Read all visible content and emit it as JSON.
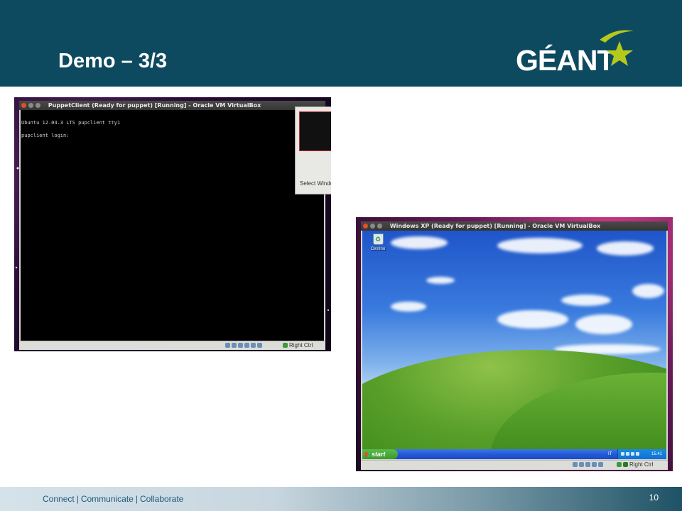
{
  "slide": {
    "title": "Demo – 3/3",
    "logo_text": "GÉANT",
    "page_number": "10"
  },
  "footer": {
    "items": [
      "Connect",
      "Communicate",
      "Collaborate"
    ],
    "separator": "|"
  },
  "screenshot_left": {
    "window_title": "PuppetClient (Ready for puppet) [Running] - Oracle VM VirtualBox",
    "console_lines": [
      "Ubuntu 12.04.3 LTS pupclient tty1",
      "pupclient login:"
    ],
    "side_panel_label": "Select Windo",
    "host_key": "Right Ctrl"
  },
  "screenshot_right": {
    "window_title": "Windows XP (Ready for puppet) [Running] - Oracle VM VirtualBox",
    "desktop_icon_label": "Cestino",
    "start_label": "start",
    "language_indicator": "IT",
    "clock": "15.41",
    "host_key": "Right Ctrl"
  },
  "colors": {
    "header_bg": "#0e4a5f",
    "logo_star": "#b5c81c",
    "tagline_text": "#1e5a7a"
  }
}
